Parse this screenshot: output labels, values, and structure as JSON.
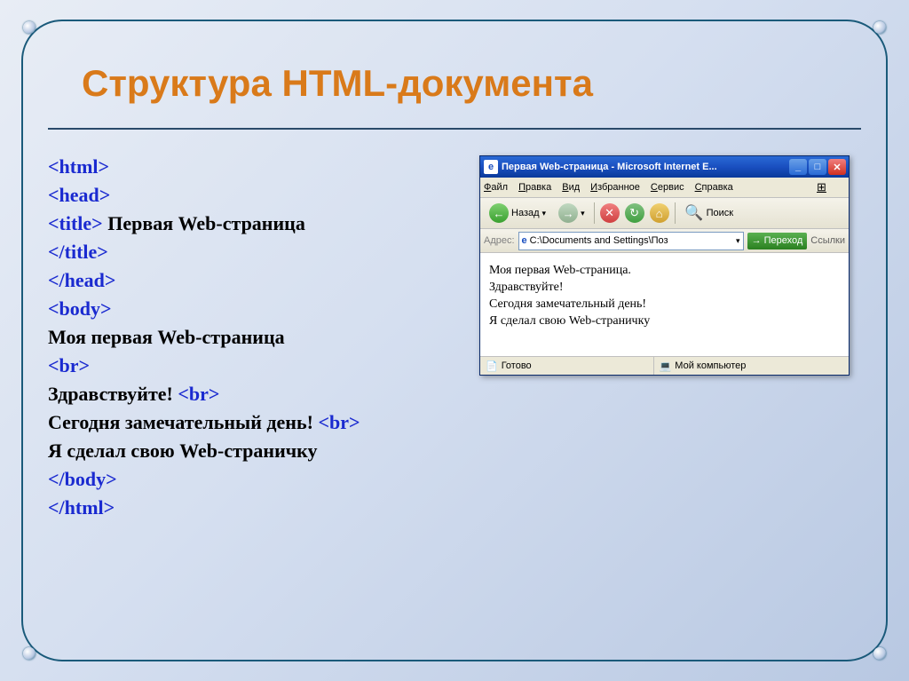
{
  "title": "Структура HTML-документа",
  "code": {
    "l1": "<html>",
    "l2": "<head>",
    "l3a": "<title>",
    "l3b": " Первая  Web-страница",
    "l4": "</title>",
    "l5": "</head>",
    "l6": "<body>",
    "l7": "Моя первая Web-страница",
    "l8": "<br>",
    "l9a": "Здравствуйте! ",
    "l9b": "<br>",
    "l10a": "Сегодня замечательный день! ",
    "l10b": "<br>",
    "l11": "Я сделал свою Web-страничку",
    "l12": "</body>",
    "l13": "</html>"
  },
  "browser": {
    "titlebar": "Первая Web-страница - Microsoft Internet E...",
    "ie_glyph": "e",
    "menu": [
      "Файл",
      "Правка",
      "Вид",
      "Избранное",
      "Сервис",
      "Справка"
    ],
    "winflag": "⊞",
    "btn_min": "_",
    "btn_max": "□",
    "btn_close": "✕",
    "back_label": "Назад",
    "back_arrow": "←",
    "fwd_arrow": "→",
    "dropdown": "▾",
    "stop": "✕",
    "reload": "↻",
    "home": "⌂",
    "search_icon": "🔍",
    "search_label": "Поиск",
    "addr_label": "Адрес:",
    "addr_value": "C:\\Documents and Settings\\Поз",
    "addr_drop": "▾",
    "go_arrow": "→",
    "go_label": "Переход",
    "links_label": "Ссылки",
    "content": {
      "l1": "Моя первая Web-страница.",
      "l2": "Здравствуйте!",
      "l3": "Сегодня замечательный день!",
      "l4": "Я сделал свою Web-страничку"
    },
    "status_ready_icon": "📄",
    "status_ready": "Готово",
    "status_zone_icon": "💻",
    "status_zone": "Мой компьютер"
  }
}
